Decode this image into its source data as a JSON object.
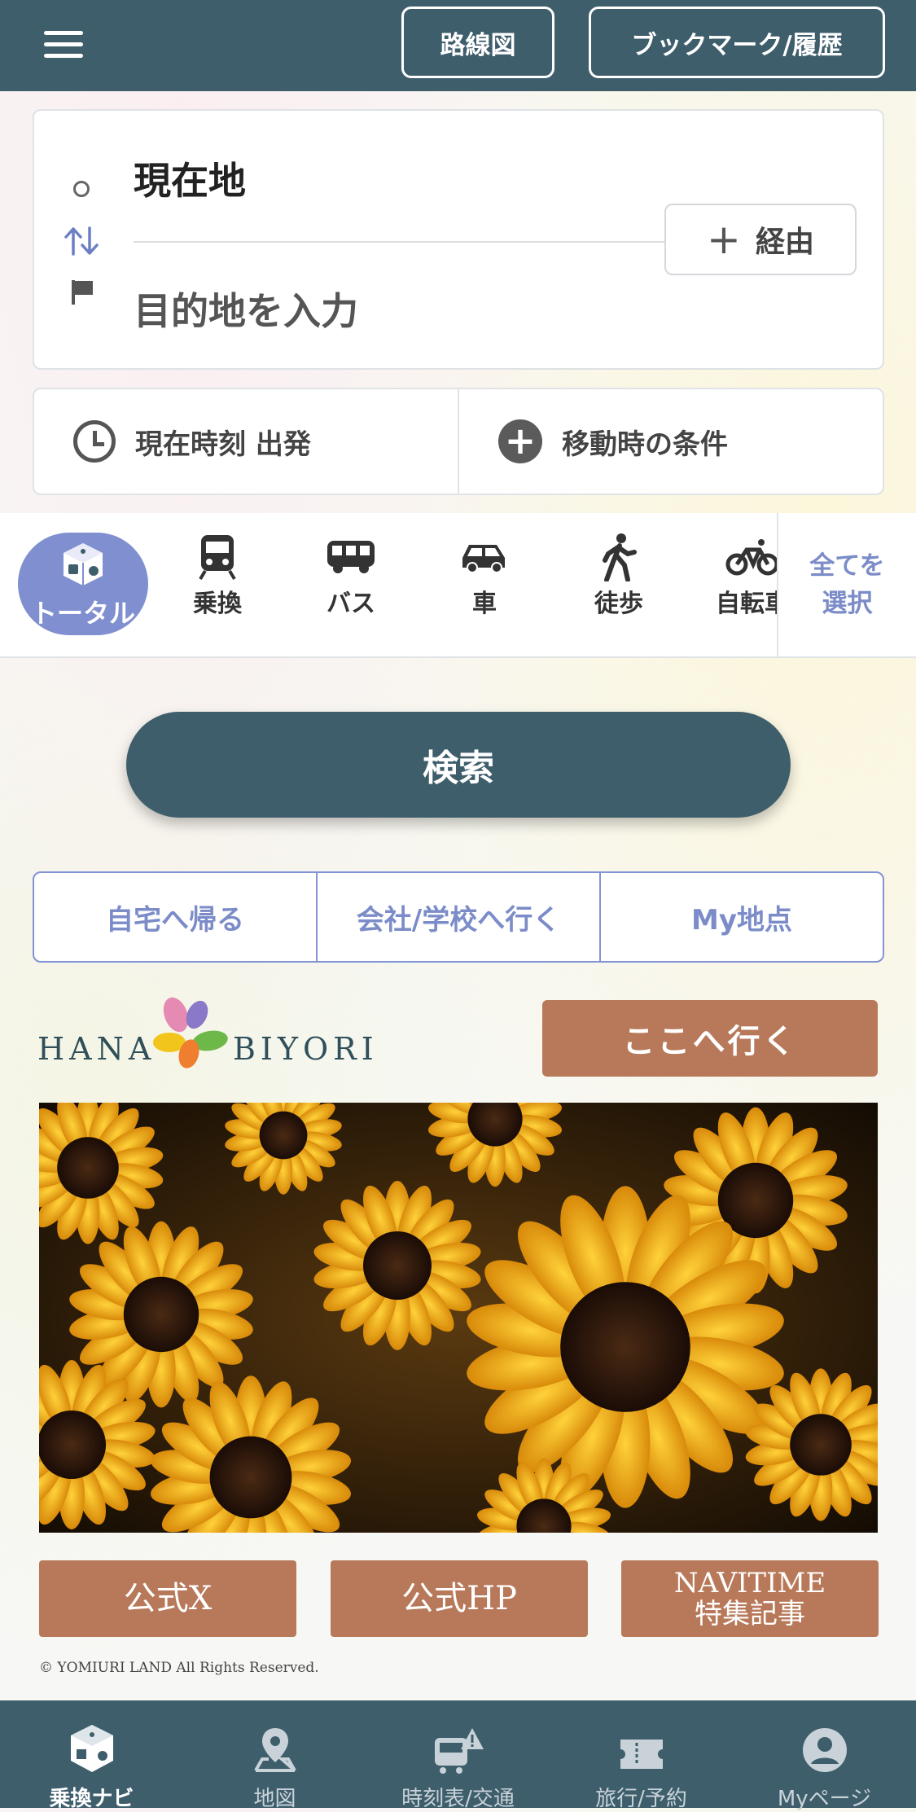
{
  "header": {
    "route_map": "路線図",
    "bookmark_history": "ブックマーク/履歴"
  },
  "search": {
    "origin": "現在地",
    "destination_placeholder": "目的地を入力",
    "via": "経由"
  },
  "conditions": {
    "departure_time": "現在時刻 出発",
    "travel_conditions": "移動時の条件"
  },
  "modes": {
    "items": [
      {
        "label": "トータル",
        "icon": "total-icon",
        "active": true
      },
      {
        "label": "乗換",
        "icon": "train-icon"
      },
      {
        "label": "バス",
        "icon": "bus-icon"
      },
      {
        "label": "車",
        "icon": "car-icon"
      },
      {
        "label": "徒歩",
        "icon": "walk-icon"
      },
      {
        "label": "自転車",
        "icon": "bicycle-icon"
      }
    ],
    "select_all": "全てを選択"
  },
  "search_button": "検索",
  "quick_links": [
    "自宅へ帰る",
    "会社/学校へ行く",
    "My地点"
  ],
  "promo": {
    "logo_left": "HANA",
    "logo_right": "BIYORI",
    "go_here": "ここへ行く",
    "buttons": [
      "公式X",
      "公式HP",
      "NAVITIME",
      "特集記事"
    ],
    "copyright": "© YOMIURI LAND All Rights Reserved."
  },
  "bottom_nav": [
    {
      "label": "乗換ナビ",
      "icon": "transit-navi-icon",
      "active": true
    },
    {
      "label": "地図",
      "icon": "map-icon"
    },
    {
      "label": "時刻表/交通",
      "icon": "timetable-icon"
    },
    {
      "label": "旅行/予約",
      "icon": "ticket-icon"
    },
    {
      "label": "Myページ",
      "icon": "account-icon"
    }
  ],
  "colors": {
    "primary": "#3e5e6c",
    "accent": "#7f8fcf",
    "promo": "#b8795a"
  }
}
